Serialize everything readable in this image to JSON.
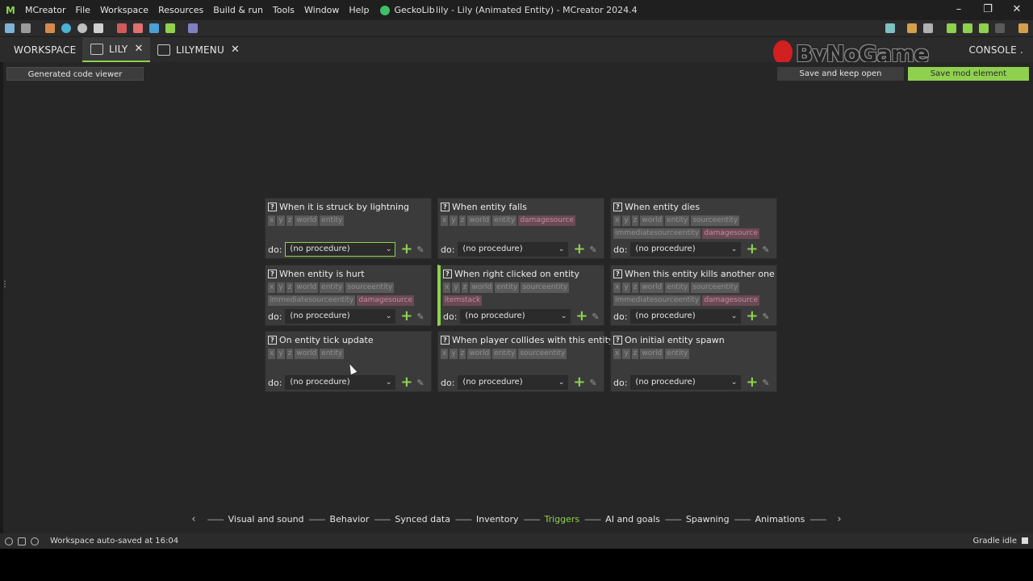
{
  "titlebar": {
    "menu": [
      "MCreator",
      "File",
      "Workspace",
      "Resources",
      "Build & run",
      "Tools",
      "Window",
      "Help"
    ],
    "geckolib": "GeckoLib",
    "title": "lily - Lily (Animated Entity) - MCreator 2024.4"
  },
  "tabs": {
    "workspace": "WORKSPACE",
    "lily": "LILY",
    "lilymenu": "LILYMENU",
    "console": "CONSOLE"
  },
  "watermark": "ByNoGame",
  "buttons": {
    "code_viewer": "Generated code viewer",
    "save_keep": "Save and keep open",
    "save_mod": "Save mod element"
  },
  "do_label": "do:",
  "triggers": [
    {
      "title": "When it is struck by lightning",
      "deps": [
        [
          "x",
          "n"
        ],
        [
          "y",
          "n"
        ],
        [
          "z",
          "n"
        ],
        [
          "world",
          "n"
        ],
        [
          "entity",
          "n"
        ]
      ],
      "procedure": "(no procedure)"
    },
    {
      "title": "When entity falls",
      "deps": [
        [
          "x",
          "n"
        ],
        [
          "y",
          "n"
        ],
        [
          "z",
          "n"
        ],
        [
          "world",
          "n"
        ],
        [
          "entity",
          "n"
        ],
        [
          "damagesource",
          "p"
        ]
      ],
      "procedure": "(no procedure)"
    },
    {
      "title": "When entity dies",
      "deps": [
        [
          "x",
          "n"
        ],
        [
          "y",
          "n"
        ],
        [
          "z",
          "n"
        ],
        [
          "world",
          "n"
        ],
        [
          "entity",
          "n"
        ],
        [
          "sourceentity",
          "n"
        ],
        [
          "immediatesourceentity",
          "n"
        ],
        [
          "damagesource",
          "p"
        ]
      ],
      "procedure": "(no procedure)"
    },
    {
      "title": "When entity is hurt",
      "deps": [
        [
          "x",
          "n"
        ],
        [
          "y",
          "n"
        ],
        [
          "z",
          "n"
        ],
        [
          "world",
          "n"
        ],
        [
          "entity",
          "n"
        ],
        [
          "sourceentity",
          "n"
        ],
        [
          "immediatesourceentity",
          "n"
        ],
        [
          "damagesource",
          "p"
        ]
      ],
      "procedure": "(no procedure)"
    },
    {
      "title": "When right clicked on entity",
      "deps": [
        [
          "x",
          "n"
        ],
        [
          "y",
          "n"
        ],
        [
          "z",
          "n"
        ],
        [
          "world",
          "n"
        ],
        [
          "entity",
          "n"
        ],
        [
          "sourceentity",
          "n"
        ],
        [
          "itemstack",
          "p"
        ]
      ],
      "procedure": "(no procedure)"
    },
    {
      "title": "When this entity kills another one",
      "deps": [
        [
          "x",
          "n"
        ],
        [
          "y",
          "n"
        ],
        [
          "z",
          "n"
        ],
        [
          "world",
          "n"
        ],
        [
          "entity",
          "n"
        ],
        [
          "sourceentity",
          "n"
        ],
        [
          "immediatesourceentity",
          "n"
        ],
        [
          "damagesource",
          "p"
        ]
      ],
      "procedure": "(no procedure)"
    },
    {
      "title": "On entity tick update",
      "deps": [
        [
          "x",
          "n"
        ],
        [
          "y",
          "n"
        ],
        [
          "z",
          "n"
        ],
        [
          "world",
          "n"
        ],
        [
          "entity",
          "n"
        ]
      ],
      "procedure": "(no procedure)"
    },
    {
      "title": "When player collides with this entity",
      "deps": [
        [
          "x",
          "n"
        ],
        [
          "y",
          "n"
        ],
        [
          "z",
          "n"
        ],
        [
          "world",
          "n"
        ],
        [
          "entity",
          "n"
        ],
        [
          "sourceentity",
          "n"
        ]
      ],
      "procedure": "(no procedure)"
    },
    {
      "title": "On initial entity spawn",
      "deps": [
        [
          "x",
          "n"
        ],
        [
          "y",
          "n"
        ],
        [
          "z",
          "n"
        ],
        [
          "world",
          "n"
        ],
        [
          "entity",
          "n"
        ]
      ],
      "procedure": "(no procedure)"
    }
  ],
  "nav": {
    "items": [
      "Visual and sound",
      "Behavior",
      "Synced data",
      "Inventory",
      "Triggers",
      "AI and goals",
      "Spawning",
      "Animations"
    ],
    "active": "Triggers"
  },
  "status": {
    "text": "Workspace auto-saved at 16:04",
    "gradle": "Gradle idle"
  },
  "colors": {
    "accent": "#8fd14f",
    "background": "#262626",
    "card": "#3b3b3b",
    "pink_chip": "#c48aa0"
  }
}
